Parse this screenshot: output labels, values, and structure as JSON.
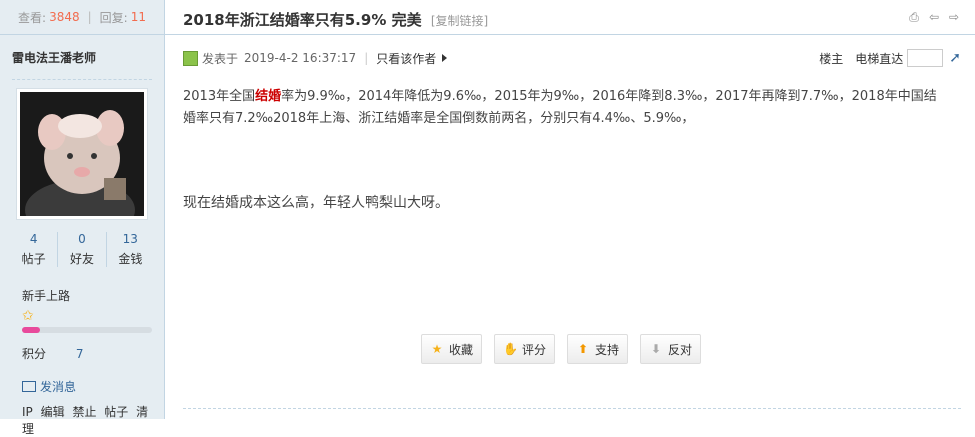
{
  "sidebar": {
    "views_label": "查看:",
    "views_count": "3848",
    "replies_label": "回复:",
    "replies_count": "11",
    "author_name": "雷电法王潘老师",
    "counts": [
      {
        "value": "4",
        "label": "帖子"
      },
      {
        "value": "0",
        "label": "好友"
      },
      {
        "value": "13",
        "label": "金钱"
      }
    ],
    "rank": "新手上路",
    "credit_label": "积分",
    "credit_value": "7",
    "send_message": "发消息",
    "admin_links": [
      "IP",
      "编辑",
      "禁止",
      "帖子",
      "清理"
    ]
  },
  "thread": {
    "title": "2018年浙江结婚率只有5.9% 完美",
    "copy_link": "[复制链接]"
  },
  "post": {
    "posted_label": "发表于",
    "posted_time": "2019-4-2 16:37:17",
    "only_author": "只看该作者",
    "floor": "楼主",
    "elevator": "电梯直达",
    "body_pre": "2013年全国",
    "body_highlight": "结婚",
    "body_post": "率为9.9‰，2014年降低为9.6‰，2015年为9‰，2016年降到8.3‰，2017年再降到7.7‰，2018年中国结婚率只有7.2‰2018年上海、浙江结婚率是全国倒数前两名，分别只有4.4‰、5.9‰，",
    "body_line2": "现在结婚成本这么高，年轻人鸭梨山大呀。"
  },
  "actions": {
    "favorite": "收藏",
    "rate": "评分",
    "support": "支持",
    "oppose": "反对"
  },
  "colors": {
    "sidebar_bg": "#E5EDF2",
    "accent_count": "#F26C4F",
    "link": "#336699",
    "highlight": "#CC0000",
    "progress": "#E84A9C"
  },
  "rank_progress_fraction": 0.14
}
